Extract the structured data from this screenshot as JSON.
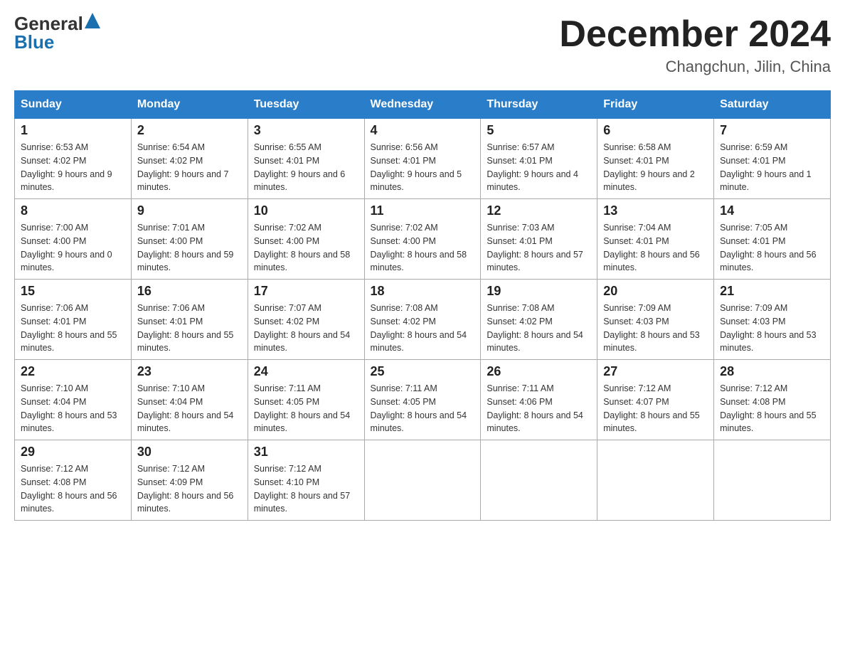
{
  "logo": {
    "text_general": "General",
    "arrow_icon": "▶",
    "text_blue": "Blue"
  },
  "header": {
    "title": "December 2024",
    "subtitle": "Changchun, Jilin, China"
  },
  "days_of_week": [
    "Sunday",
    "Monday",
    "Tuesday",
    "Wednesday",
    "Thursday",
    "Friday",
    "Saturday"
  ],
  "weeks": [
    [
      {
        "day": "1",
        "sunrise": "6:53 AM",
        "sunset": "4:02 PM",
        "daylight": "9 hours and 9 minutes."
      },
      {
        "day": "2",
        "sunrise": "6:54 AM",
        "sunset": "4:02 PM",
        "daylight": "9 hours and 7 minutes."
      },
      {
        "day": "3",
        "sunrise": "6:55 AM",
        "sunset": "4:01 PM",
        "daylight": "9 hours and 6 minutes."
      },
      {
        "day": "4",
        "sunrise": "6:56 AM",
        "sunset": "4:01 PM",
        "daylight": "9 hours and 5 minutes."
      },
      {
        "day": "5",
        "sunrise": "6:57 AM",
        "sunset": "4:01 PM",
        "daylight": "9 hours and 4 minutes."
      },
      {
        "day": "6",
        "sunrise": "6:58 AM",
        "sunset": "4:01 PM",
        "daylight": "9 hours and 2 minutes."
      },
      {
        "day": "7",
        "sunrise": "6:59 AM",
        "sunset": "4:01 PM",
        "daylight": "9 hours and 1 minute."
      }
    ],
    [
      {
        "day": "8",
        "sunrise": "7:00 AM",
        "sunset": "4:00 PM",
        "daylight": "9 hours and 0 minutes."
      },
      {
        "day": "9",
        "sunrise": "7:01 AM",
        "sunset": "4:00 PM",
        "daylight": "8 hours and 59 minutes."
      },
      {
        "day": "10",
        "sunrise": "7:02 AM",
        "sunset": "4:00 PM",
        "daylight": "8 hours and 58 minutes."
      },
      {
        "day": "11",
        "sunrise": "7:02 AM",
        "sunset": "4:00 PM",
        "daylight": "8 hours and 58 minutes."
      },
      {
        "day": "12",
        "sunrise": "7:03 AM",
        "sunset": "4:01 PM",
        "daylight": "8 hours and 57 minutes."
      },
      {
        "day": "13",
        "sunrise": "7:04 AM",
        "sunset": "4:01 PM",
        "daylight": "8 hours and 56 minutes."
      },
      {
        "day": "14",
        "sunrise": "7:05 AM",
        "sunset": "4:01 PM",
        "daylight": "8 hours and 56 minutes."
      }
    ],
    [
      {
        "day": "15",
        "sunrise": "7:06 AM",
        "sunset": "4:01 PM",
        "daylight": "8 hours and 55 minutes."
      },
      {
        "day": "16",
        "sunrise": "7:06 AM",
        "sunset": "4:01 PM",
        "daylight": "8 hours and 55 minutes."
      },
      {
        "day": "17",
        "sunrise": "7:07 AM",
        "sunset": "4:02 PM",
        "daylight": "8 hours and 54 minutes."
      },
      {
        "day": "18",
        "sunrise": "7:08 AM",
        "sunset": "4:02 PM",
        "daylight": "8 hours and 54 minutes."
      },
      {
        "day": "19",
        "sunrise": "7:08 AM",
        "sunset": "4:02 PM",
        "daylight": "8 hours and 54 minutes."
      },
      {
        "day": "20",
        "sunrise": "7:09 AM",
        "sunset": "4:03 PM",
        "daylight": "8 hours and 53 minutes."
      },
      {
        "day": "21",
        "sunrise": "7:09 AM",
        "sunset": "4:03 PM",
        "daylight": "8 hours and 53 minutes."
      }
    ],
    [
      {
        "day": "22",
        "sunrise": "7:10 AM",
        "sunset": "4:04 PM",
        "daylight": "8 hours and 53 minutes."
      },
      {
        "day": "23",
        "sunrise": "7:10 AM",
        "sunset": "4:04 PM",
        "daylight": "8 hours and 54 minutes."
      },
      {
        "day": "24",
        "sunrise": "7:11 AM",
        "sunset": "4:05 PM",
        "daylight": "8 hours and 54 minutes."
      },
      {
        "day": "25",
        "sunrise": "7:11 AM",
        "sunset": "4:05 PM",
        "daylight": "8 hours and 54 minutes."
      },
      {
        "day": "26",
        "sunrise": "7:11 AM",
        "sunset": "4:06 PM",
        "daylight": "8 hours and 54 minutes."
      },
      {
        "day": "27",
        "sunrise": "7:12 AM",
        "sunset": "4:07 PM",
        "daylight": "8 hours and 55 minutes."
      },
      {
        "day": "28",
        "sunrise": "7:12 AM",
        "sunset": "4:08 PM",
        "daylight": "8 hours and 55 minutes."
      }
    ],
    [
      {
        "day": "29",
        "sunrise": "7:12 AM",
        "sunset": "4:08 PM",
        "daylight": "8 hours and 56 minutes."
      },
      {
        "day": "30",
        "sunrise": "7:12 AM",
        "sunset": "4:09 PM",
        "daylight": "8 hours and 56 minutes."
      },
      {
        "day": "31",
        "sunrise": "7:12 AM",
        "sunset": "4:10 PM",
        "daylight": "8 hours and 57 minutes."
      },
      null,
      null,
      null,
      null
    ]
  ],
  "labels": {
    "sunrise": "Sunrise:",
    "sunset": "Sunset:",
    "daylight": "Daylight:"
  }
}
